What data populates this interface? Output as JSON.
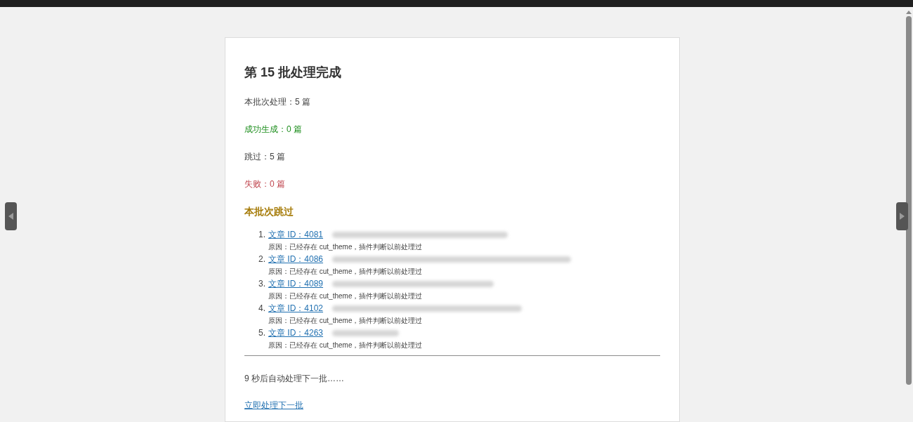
{
  "title": "第 15 批处理完成",
  "stats": [
    {
      "kind": "plain",
      "text": "本批次处理：5 篇"
    },
    {
      "kind": "success",
      "text": "成功生成：0 篇"
    },
    {
      "kind": "plain",
      "text": "跳过：5 篇"
    },
    {
      "kind": "failure",
      "text": "失败：0 篇"
    }
  ],
  "skipped_heading": "本批次跳过",
  "skipped": [
    {
      "number": "1.",
      "link": "文章 ID：4081",
      "title_blurred": true,
      "reason": "原因：已经存在 cut_theme，插件判断以前处理过"
    },
    {
      "number": "2.",
      "link": "文章 ID：4086",
      "title_blurred": true,
      "reason": "原因：已经存在 cut_theme，插件判断以前处理过"
    },
    {
      "number": "3.",
      "link": "文章 ID：4089",
      "title_blurred": true,
      "reason": "原因：已经存在 cut_theme，插件判断以前处理过"
    },
    {
      "number": "4.",
      "link": "文章 ID：4102",
      "title_blurred": true,
      "reason": "原因：已经存在 cut_theme，插件判断以前处理过"
    },
    {
      "number": "5.",
      "link": "文章 ID：4263",
      "title_blurred": true,
      "reason": "原因：已经存在 cut_theme，插件判断以前处理过"
    }
  ],
  "countdown": "9 秒后自动处理下一批……",
  "next_link": "立即处理下一批"
}
